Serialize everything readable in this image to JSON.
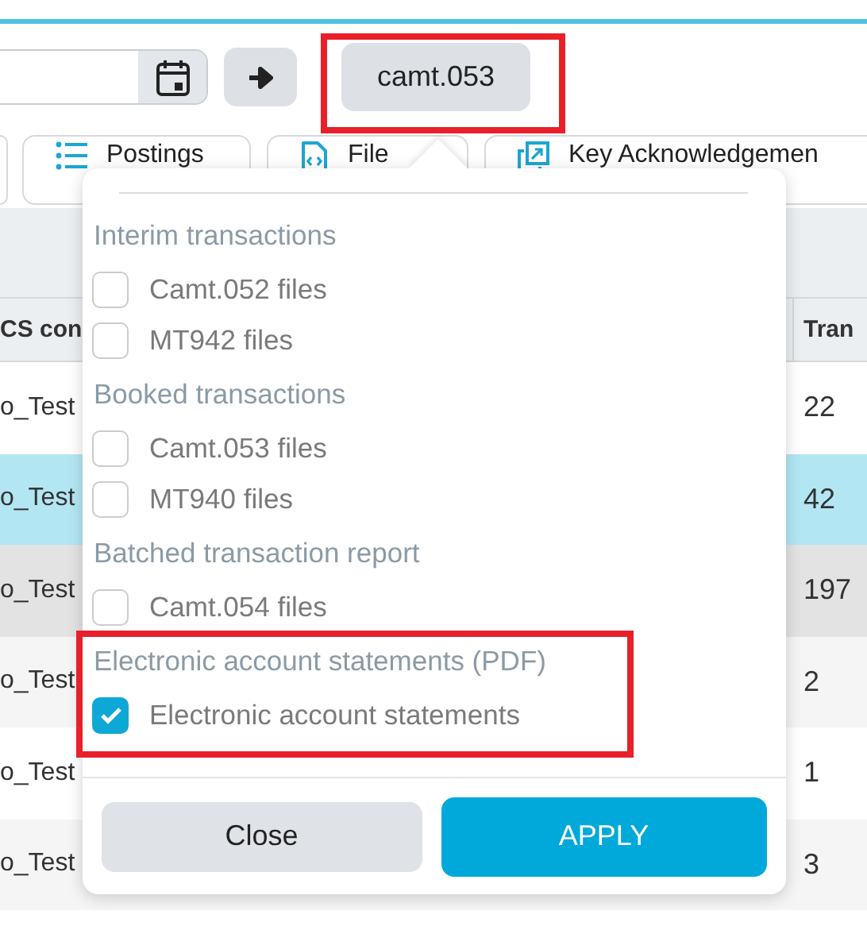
{
  "toolbar": {
    "format_button": {
      "label": "camt.053"
    }
  },
  "tabs": [
    {
      "label": "Postings",
      "kind": "list"
    },
    {
      "label": "File",
      "kind": "file"
    },
    {
      "label": "Key Acknowledgemen",
      "kind": "copy"
    }
  ],
  "table": {
    "columns": [
      "CS con",
      "Tran"
    ],
    "rows": [
      {
        "cells": [
          "o_Test",
          "22"
        ],
        "selected": false,
        "hovered": false
      },
      {
        "cells": [
          "o_Test",
          "42"
        ],
        "selected": true,
        "hovered": false
      },
      {
        "cells": [
          "o_Test",
          "197"
        ],
        "selected": false,
        "hovered": true
      },
      {
        "cells": [
          "o_Test",
          "2"
        ],
        "selected": false,
        "hovered": false
      },
      {
        "cells": [
          "o_Test",
          "1"
        ],
        "selected": false,
        "hovered": false
      },
      {
        "cells": [
          "o_Test",
          "3"
        ],
        "selected": false,
        "hovered": false
      }
    ]
  },
  "popup": {
    "groups": [
      {
        "heading": "Interim transactions",
        "options": [
          {
            "label": "Camt.052 files",
            "checked": false
          },
          {
            "label": "MT942 files",
            "checked": false
          }
        ]
      },
      {
        "heading": "Booked transactions",
        "options": [
          {
            "label": "Camt.053 files",
            "checked": false
          },
          {
            "label": "MT940 files",
            "checked": false
          }
        ]
      },
      {
        "heading": "Batched transaction report",
        "options": [
          {
            "label": "Camt.054 files",
            "checked": false
          }
        ]
      },
      {
        "heading": "Electronic account statements (PDF)",
        "options": [
          {
            "label": "Electronic account statements",
            "checked": true
          }
        ]
      }
    ],
    "buttons": [
      {
        "label": "Close",
        "kind": "secondary"
      },
      {
        "label": "APPLY",
        "kind": "primary"
      }
    ]
  }
}
